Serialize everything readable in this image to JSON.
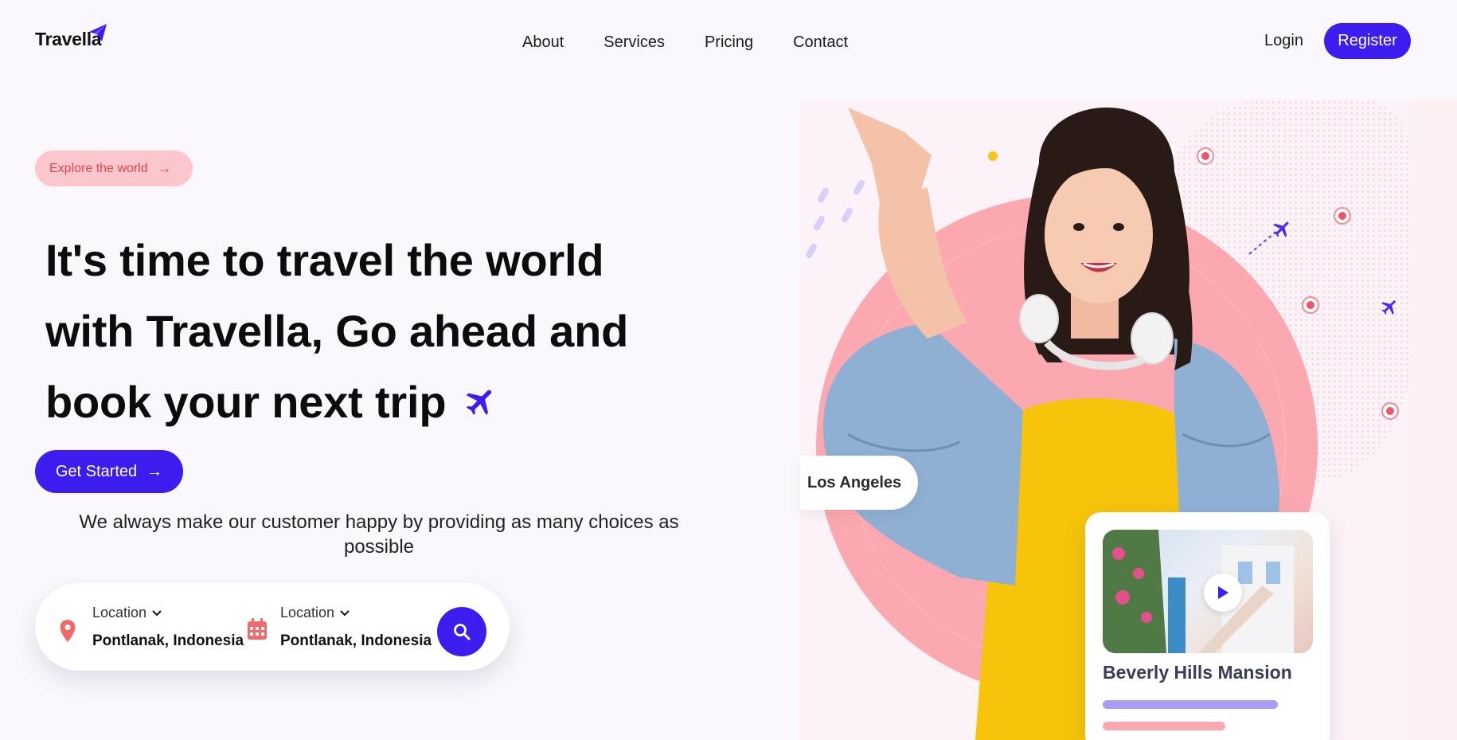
{
  "brand": {
    "name": "Travella",
    "accent": "#3d1cf0",
    "logo_icon": "paper-plane-icon"
  },
  "nav": {
    "items": [
      {
        "label": "About"
      },
      {
        "label": "Services"
      },
      {
        "label": "Pricing"
      },
      {
        "label": "Contact"
      }
    ],
    "login_label": "Login",
    "register_label": "Register"
  },
  "hero": {
    "badge": {
      "label": "Explore the world",
      "icon": "arrow-right-icon",
      "bg": "#fcc7cc",
      "color": "#e0454f"
    },
    "title_lines": [
      "It's time to travel the world",
      "with Travella, Go ahead and",
      "book your next trip"
    ],
    "title_icon": "airplane-icon",
    "cta_label": "Get Started",
    "subtitle": "We always make our customer happy by providing as many choices as possible"
  },
  "search": {
    "fields": [
      {
        "label": "Location",
        "value": "Pontlanak, Indonesia",
        "icon": "map-pin-icon"
      },
      {
        "label": "Location",
        "value": "Pontlanak, Indonesia",
        "icon": "calendar-icon"
      }
    ],
    "button_icon": "search-icon"
  },
  "visual": {
    "location_tag": "Los Angeles",
    "property_card": {
      "title": "Beverly Hills Mansion",
      "icon": "play-icon"
    }
  }
}
